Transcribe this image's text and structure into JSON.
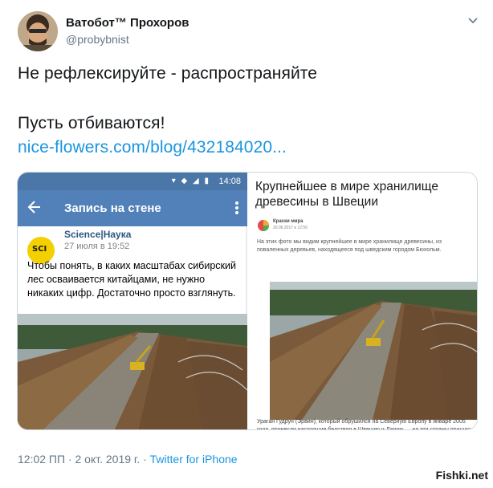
{
  "tweet": {
    "author_name": "Ватобот™ Прохоров",
    "author_handle": "@probybnist",
    "line1": "Не рефлексируйте - распространяйте",
    "line2": "Пусть отбиваются!",
    "link": "nice-flowers.com/blog/432184020...",
    "footer_time": "12:02 ПП · 2 окт. 2019 г. · ",
    "footer_via": "Twitter for iPhone"
  },
  "left_image": {
    "status_time": "14:08",
    "appbar_title": "Запись на стене",
    "post_author": "Science|Наука",
    "post_date": "27 июля в 19:52",
    "avatar_text": "SCI",
    "post_text": "Чтобы понять, в каких масштабах сибирский лес осваивается китайцами, не нужно никаких цифр. Достаточно просто взглянуть."
  },
  "right_image": {
    "title": "Крупнейшее в мире хранилище древесины в Швеции",
    "source_name": "Краски мира",
    "source_date": "20.06.2017 в 12:56",
    "description": "На этих фото мы видим крупнейшее в мире хранилище древесины, из поваленных деревьев, находящееся под шведским городом Бюхольм.",
    "caption": "Ураган Гудрун (Эрвин), который обрушился на Северную Европу в январе 2005 года, принесли настоящие бедствия в Швецию и Данию — на эти страны пришлось основное..."
  },
  "watermark": "Fishki.net",
  "colors": {
    "twitter_blue": "#1b95e0",
    "vk_blue": "#5181b8",
    "vk_status": "#4a76a8"
  }
}
